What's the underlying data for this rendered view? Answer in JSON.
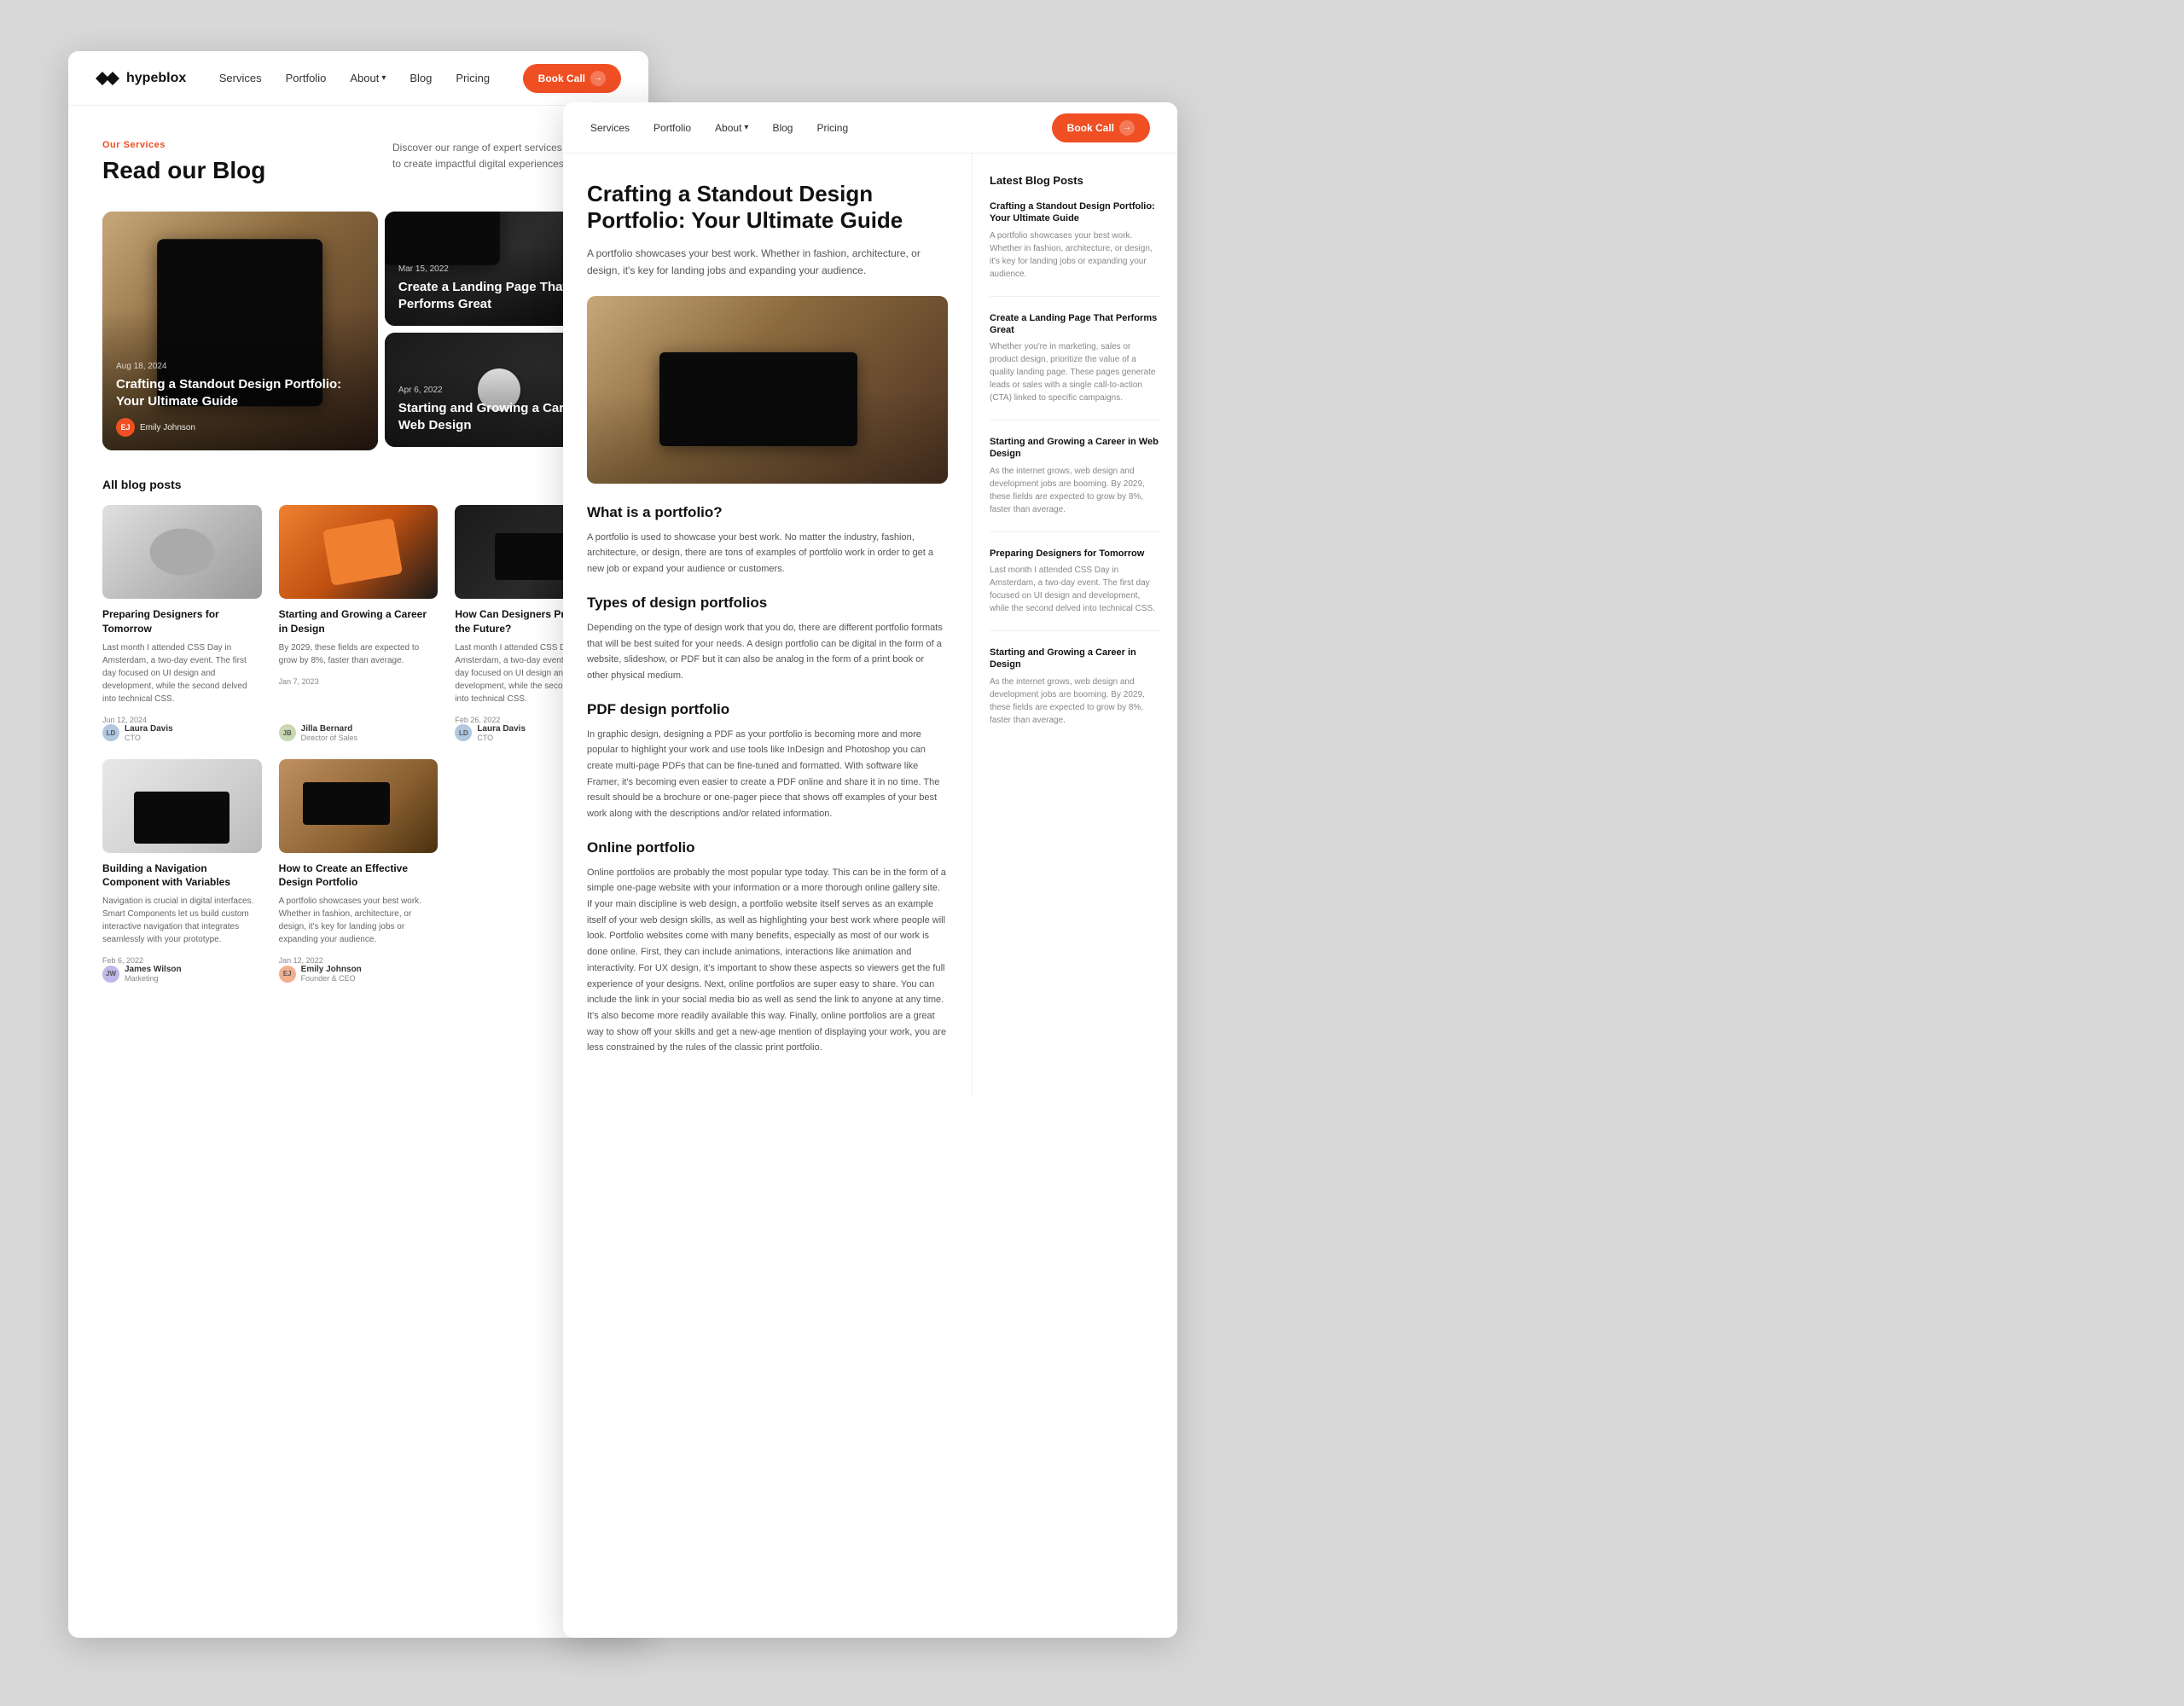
{
  "meta": {
    "screenshot_width": 2560,
    "screenshot_height": 2000
  },
  "left_window": {
    "nav": {
      "logo": "hypeblox",
      "links": [
        {
          "label": "Services",
          "has_arrow": false
        },
        {
          "label": "Portfolio",
          "has_arrow": false
        },
        {
          "label": "About",
          "has_arrow": true
        },
        {
          "label": "Blog",
          "has_arrow": false
        },
        {
          "label": "Pricing",
          "has_arrow": false
        }
      ],
      "cta": "Book Call"
    },
    "page_label": "Our Services",
    "page_title": "Read our Blog",
    "page_desc": "Discover our range of expert services designed to create impactful digital experiences.",
    "featured_posts": [
      {
        "id": "feat-large",
        "date": "Aug 18, 2024",
        "title": "Crafting a Standout Design Portfolio: Your Ultimate Guide",
        "author_name": "Emily Johnson",
        "img_type": "portfolio"
      },
      {
        "id": "feat-small-1",
        "date": "Mar 15, 2022",
        "title": "Create a Landing Page That Performs Great",
        "img_type": "landing"
      },
      {
        "id": "feat-small-2",
        "date": "Apr 6, 2022",
        "title": "Starting and Growing a Career in Web Design",
        "img_type": "career"
      }
    ],
    "all_posts_label": "All blog posts",
    "blog_cards": [
      {
        "title": "Preparing Designers for Tomorrow",
        "excerpt": "Last month I attended CSS Day in Amsterdam, a two-day event. The first day focused on UI design and development, while the second delved into technical CSS.",
        "date": "Jun 12, 2024",
        "author_name": "Laura Davis",
        "author_role": "CTO",
        "img_type": "preparing"
      },
      {
        "title": "Starting and Growing a Career in Design",
        "excerpt": "By 2029, these fields are expected to grow by 8%, faster than average.",
        "date": "Jan 7, 2023",
        "author_name": "Jilla Bernard",
        "author_role": "Director of Sales",
        "img_type": "growing"
      },
      {
        "title": "How Can Designers Prepare for the Future?",
        "excerpt": "Last month I attended CSS Day in Amsterdam, a two-day event. The first day focused on UI design and development, while the second delved into technical CSS.",
        "date": "Feb 26, 2022",
        "author_name": "Laura Davis",
        "author_role": "CTO",
        "img_type": "designers"
      },
      {
        "title": "Building a Navigation Component with Variables",
        "excerpt": "Navigation is crucial in digital interfaces. Smart Components let us build custom interactive navigation that integrates seamlessly with your prototype.",
        "date": "Feb 6, 2022",
        "author_name": "James Wilson",
        "author_role": "Marketing",
        "img_type": "building"
      },
      {
        "title": "How to Create an Effective Design Portfolio",
        "excerpt": "A portfolio showcases your best work. Whether in fashion, architecture, or design, it's key for landing jobs or expanding your audience.",
        "date": "Jan 12, 2022",
        "author_name": "Emily Johnson",
        "author_role": "Founder & CEO",
        "img_type": "effective"
      }
    ]
  },
  "right_window": {
    "nav": {
      "links": [
        {
          "label": "Services"
        },
        {
          "label": "Portfolio"
        },
        {
          "label": "About",
          "has_arrow": true
        },
        {
          "label": "Blog"
        },
        {
          "label": "Pricing"
        }
      ],
      "cta": "Book Call"
    },
    "post": {
      "title": "Crafting a Standout Design Portfolio: Your Ultimate Guide",
      "subtitle": "A portfolio showcases your best work. Whether in fashion, architecture, or design, it's key for landing jobs and expanding your audience.",
      "what_is_title": "What is a portfolio?",
      "what_is_text": "A portfolio is used to showcase your best work. No matter the industry, fashion, architecture, or design, there are tons of examples of portfolio work in order to get a new job or expand your audience or customers.",
      "types_title": "Types of design portfolios",
      "types_text": "Depending on the type of design work that you do, there are different portfolio formats that will be best suited for your needs. A design portfolio can be digital in the form of a website, slideshow, or PDF but it can also be analog in the form of a print book or other physical medium.",
      "pdf_title": "PDF design portfolio",
      "pdf_text": "In graphic design, designing a PDF as your portfolio is becoming more and more popular to highlight your work and use tools like InDesign and Photoshop you can create multi-page PDFs that can be fine-tuned and formatted. With software like Framer, it's becoming even easier to create a PDF online and share it in no time. The result should be a brochure or one-pager piece that shows off examples of your best work along with the descriptions and/or related information.",
      "online_title": "Online portfolio",
      "online_text": "Online portfolios are probably the most popular type today. This can be in the form of a simple one-page website with your information or a more thorough online gallery site. If your main discipline is web design, a portfolio website itself serves as an example itself of your web design skills, as well as highlighting your best work where people will look. Portfolio websites come with many benefits, especially as most of our work is done online. First, they can include animations, interactions like animation and interactivity. For UX design, it's important to show these aspects so viewers get the full experience of your designs. Next, online portfolios are super easy to share. You can include the link in your social media bio as well as send the link to anyone at any time. It's also become more readily available this way. Finally, online portfolios are a great way to show off your skills and get a new-age mention of displaying your work, you are less constrained by the rules of the classic print portfolio."
    },
    "sidebar": {
      "title": "Latest Blog Posts",
      "posts": [
        {
          "title": "Crafting a Standout Design Portfolio: Your Ultimate Guide",
          "excerpt": "A portfolio showcases your best work. Whether in fashion, architecture, or design, it's key for landing jobs or expanding your audience."
        },
        {
          "title": "Create a Landing Page That Performs Great",
          "excerpt": "Whether you're in marketing, sales or product design, prioritize the value of a quality landing page. These pages generate leads or sales with a single call-to-action (CTA) linked to specific campaigns."
        },
        {
          "title": "Starting and Growing a Career in Web Design",
          "excerpt": "As the internet grows, web design and development jobs are booming. By 2029, these fields are expected to grow by 8%, faster than average."
        },
        {
          "title": "Preparing Designers for Tomorrow",
          "excerpt": "Last month I attended CSS Day in Amsterdam, a two-day event. The first day focused on UI design and development, while the second delved into technical CSS."
        },
        {
          "title": "Starting and Growing a Career in Design",
          "excerpt": "As the internet grows, web design and development jobs are booming. By 2029, these fields are expected to grow by 8%, faster than average."
        }
      ]
    }
  }
}
